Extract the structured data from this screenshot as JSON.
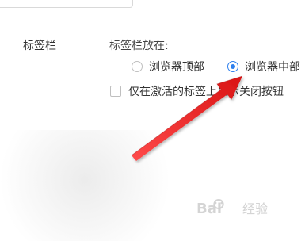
{
  "section": {
    "title": "标签栏"
  },
  "tab_bar_position": {
    "label": "标签栏放在:",
    "options": [
      {
        "label": "浏览器顶部",
        "checked": false
      },
      {
        "label": "浏览器中部",
        "checked": true
      }
    ]
  },
  "close_button_option": {
    "label": "仅在激活的标签上显示关闭按钮",
    "checked": false
  },
  "watermark": {
    "text": "Bai 经验"
  },
  "colors": {
    "accent": "#2f80ed",
    "annotation": "#e52a2a"
  }
}
